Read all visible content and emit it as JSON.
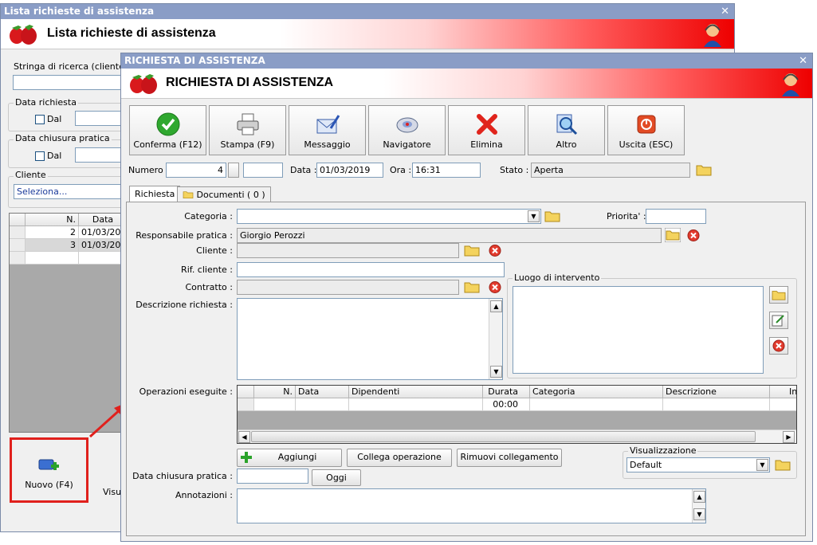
{
  "back_window": {
    "title": "Lista richieste di assistenza",
    "banner_title": "Lista richieste di assistenza",
    "search_label": "Stringa di ricerca (cliente, n",
    "search_value": "",
    "data_richiesta_label": "Data richiesta",
    "dal_label": "Dal",
    "data_chiusura_label": "Data chiusura pratica",
    "dal_label_2": "Dal",
    "cliente_label": "Cliente",
    "cliente_value": "Seleziona...",
    "grid": {
      "headers": [
        "N.",
        "Data"
      ],
      "rows": [
        [
          "2",
          "01/03/201"
        ],
        [
          "3",
          "01/03/201"
        ]
      ]
    },
    "nuovo_label": "Nuovo (F4)",
    "visua_label": "Visua"
  },
  "front_window": {
    "title": "RICHIESTA DI ASSISTENZA",
    "banner_title": "RICHIESTA DI ASSISTENZA",
    "toolbar": [
      {
        "label": "Conferma (F12)",
        "icon": "check-icon"
      },
      {
        "label": "Stampa (F9)",
        "icon": "printer-icon"
      },
      {
        "label": "Messaggio",
        "icon": "message-icon"
      },
      {
        "label": "Navigatore",
        "icon": "navigator-icon"
      },
      {
        "label": "Elimina",
        "icon": "delete-icon"
      },
      {
        "label": "Altro",
        "icon": "magnifier-icon"
      },
      {
        "label": "Uscita (ESC)",
        "icon": "exit-icon"
      }
    ],
    "numero_label": "Numero :",
    "numero_value": "4",
    "data_label": "Data :",
    "data_value": "01/03/2019",
    "ora_label": "Ora :",
    "ora_value": "16:31",
    "stato_label": "Stato :",
    "stato_value": "Aperta",
    "tabs": [
      "Richiesta",
      "Documenti ( 0 )"
    ],
    "categoria_label": "Categoria :",
    "priorita_label": "Priorita' :",
    "responsabile_label": "Responsabile pratica :",
    "responsabile_value": "Giorgio Perozzi",
    "cliente_label": "Cliente :",
    "rif_cliente_label": "Rif. cliente :",
    "contratto_label": "Contratto :",
    "luogo_label": "Luogo di intervento",
    "descrizione_label": "Descrizione richiesta :",
    "operazioni_label": "Operazioni eseguite :",
    "ops_grid": {
      "headers": [
        "N.",
        "Data",
        "Dipendenti",
        "Durata",
        "Categoria",
        "Descrizione",
        "In"
      ],
      "row": [
        "",
        "",
        "",
        "00:00",
        "",
        "",
        ""
      ]
    },
    "aggiungi_label": "Aggiungi",
    "collega_label": "Collega operazione",
    "rimuovi_label": "Rimuovi collegamento",
    "visualizzazione_label": "Visualizzazione",
    "visualizzazione_value": "Default",
    "data_chiusura_label": "Data chiusura pratica :",
    "oggi_label": "Oggi",
    "annotazioni_label": "Annotazioni :"
  },
  "colors": {
    "titlebar": "#8a9dc6",
    "highlight": "#e0201c"
  }
}
